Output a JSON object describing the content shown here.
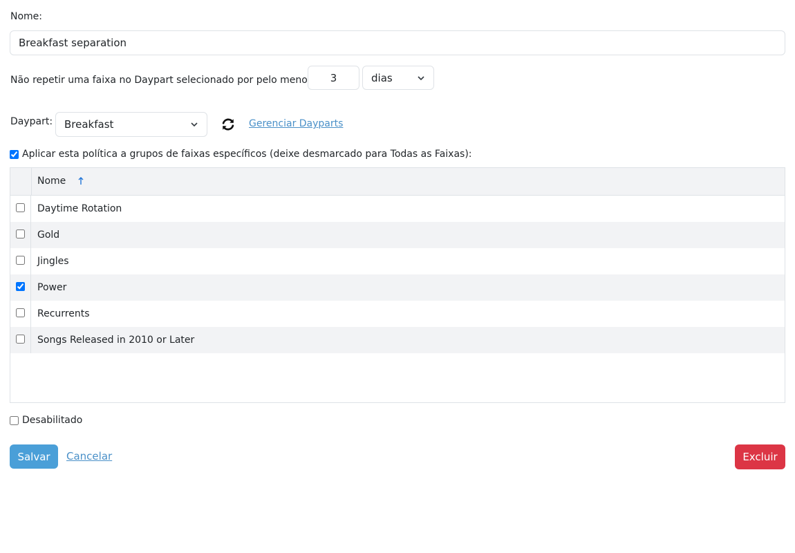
{
  "form": {
    "name_label": "Nome:",
    "name_value": "Breakfast separation",
    "repeat_label": "Não repetir uma faixa no Daypart selecionado por pelo menos",
    "repeat_value": "3",
    "repeat_unit": "dias",
    "daypart_label": "Daypart:",
    "daypart_value": "Breakfast",
    "manage_link": "Gerenciar Dayparts",
    "apply_label": "Aplicar esta política a grupos de faixas específicos (deixe desmarcado para Todas as Faixas):",
    "apply_checked": true,
    "disabled_label": "Desabilitado",
    "disabled_checked": false
  },
  "table": {
    "column_header": "Nome",
    "rows": [
      {
        "name": "Daytime Rotation",
        "checked": false
      },
      {
        "name": "Gold",
        "checked": false
      },
      {
        "name": "Jingles",
        "checked": false
      },
      {
        "name": "Power",
        "checked": true
      },
      {
        "name": "Recurrents",
        "checked": false
      },
      {
        "name": "Songs Released in 2010 or Later",
        "checked": false
      }
    ]
  },
  "actions": {
    "save": "Salvar",
    "cancel": "Cancelar",
    "delete": "Excluir"
  },
  "colors": {
    "primary": "#4a9fd8",
    "danger": "#dc3545",
    "link": "#4a90c8"
  },
  "icons": {
    "refresh": "refresh-icon",
    "chevron": "chevron-down-icon",
    "sort": "sort-ascending-icon"
  }
}
